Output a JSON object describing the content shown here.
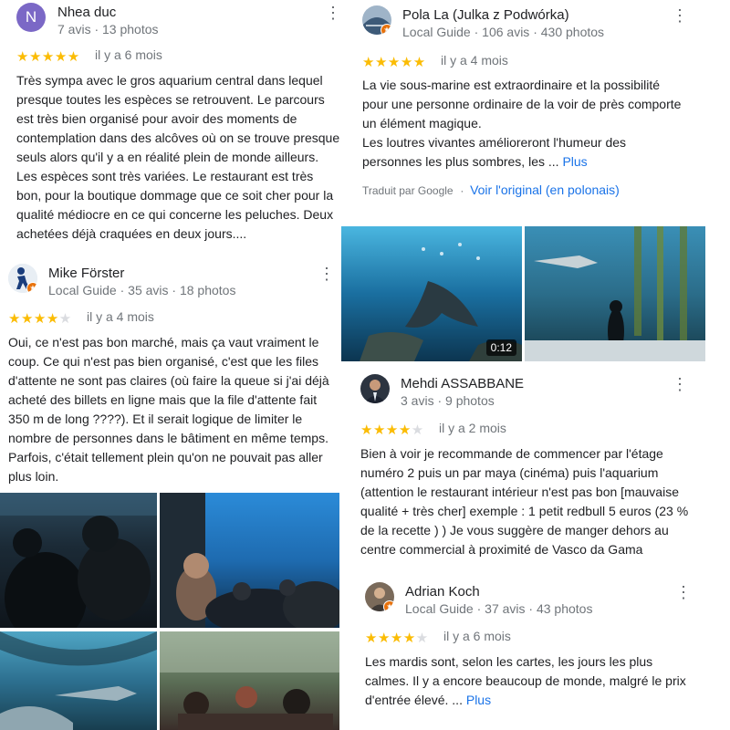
{
  "reviews": [
    {
      "name": "Nhea duc",
      "avatar_letter": "N",
      "meta": "7 avis · 13 photos",
      "rating": 5,
      "when": "il y a 6 mois",
      "text": "Très sympa avec le gros aquarium central dans lequel presque toutes les espèces se retrouvent. Le parcours est très bien organisé pour avoir des moments de contemplation dans des alcôves où on se trouve presque seuls alors qu'il y a en réalité plein de monde ailleurs. Les espèces sont très variées. Le restaurant est très bon, pour la boutique dommage que ce soit cher pour la qualité médiocre en ce qui concerne les peluches. Deux achetées déjà craquées en deux jours...."
    },
    {
      "name": "Mike Förster",
      "meta": "Local Guide · 35 avis · 18 photos",
      "rating": 4,
      "when": "il y a 4 mois",
      "text": "Oui, ce n'est pas bon marché, mais ça vaut vraiment le coup. Ce qui n'est pas bien organisé, c'est que les files d'attente ne sont pas claires (où faire la queue si j'ai déjà acheté des billets en ligne mais que la file d'attente fait 350 m de long ????). Et il serait logique de limiter le nombre de personnes dans le bâtiment en même temps. Parfois, c'était tellement plein qu'on ne pouvait pas aller plus loin."
    },
    {
      "name": "Pola La (Julka z Podwórka)",
      "meta": "Local Guide · 106 avis · 430 photos",
      "rating": 5,
      "when": "il y a 4 mois",
      "text": "La vie sous-marine est extraordinaire et la possibilité pour une personne ordinaire de la voir de près comporte un élément magique.\nLes loutres vivantes amélioreront l'humeur des personnes les plus sombres, les ... ",
      "more": "Plus",
      "translated": "Traduit par Google",
      "original_link": "Voir l'original (en polonais)",
      "video_duration": "0:12"
    },
    {
      "name": "Mehdi ASSABBANE",
      "meta": "3 avis · 9 photos",
      "rating": 4,
      "when": "il y a 2 mois",
      "text": "Bien à voir je recommande de commencer par l'étage numéro 2 puis un par maya (cinéma) puis l'aquarium (attention le restaurant intérieur n'est pas bon [mauvaise qualité + très cher] exemple : 1 petit redbull 5 euros (23 % de la recette ) ) Je vous suggère de manger dehors au centre commercial à proximité de Vasco da Gama"
    },
    {
      "name": "Adrian Koch",
      "meta": "Local Guide · 37 avis · 43 photos",
      "rating": 4,
      "when": "il y a 6 mois",
      "text": "Les mardis sont, selon les cartes, les jours les plus calmes. Il y a encore beaucoup de monde, malgré le prix d'entrée élevé. ... ",
      "more": "Plus"
    }
  ],
  "icons": {
    "more": "more-vert-icon",
    "star": "star-icon",
    "local_guide": "local-guide-badge-icon"
  },
  "colors": {
    "star": "#fbbc04",
    "link": "#1a73e8",
    "meta": "#70757a"
  }
}
